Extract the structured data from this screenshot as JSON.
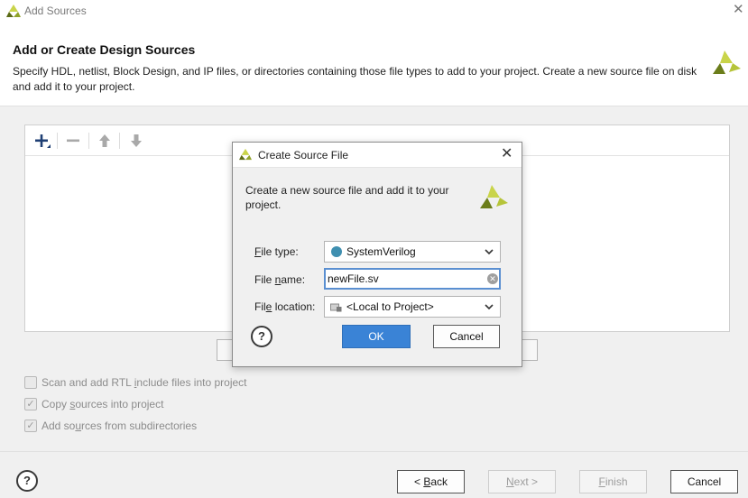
{
  "window": {
    "title": "Add Sources",
    "close_glyph": "✕"
  },
  "header": {
    "title": "Add or Create Design Sources",
    "description": "Specify HDL, netlist, Block Design, and IP files, or directories containing those file types to add to your project. Create a new source file on disk and add it to your project."
  },
  "toolbar": {
    "icons": [
      "add-icon",
      "remove-icon",
      "move-up-icon",
      "move-down-icon"
    ]
  },
  "options": [
    {
      "pre": "Scan and add RTL ",
      "u": "i",
      "post": "nclude files into project",
      "checked": false
    },
    {
      "pre": "Copy ",
      "u": "s",
      "post": "ources into project",
      "checked": true
    },
    {
      "pre": "Add so",
      "u": "u",
      "post": "rces from subdirectories",
      "checked": true
    }
  ],
  "footer": {
    "help": "?",
    "back": {
      "pre": "< ",
      "u": "B",
      "post": "ack"
    },
    "next": {
      "pre": "",
      "u": "N",
      "post": "ext >"
    },
    "finish": {
      "pre": "",
      "u": "F",
      "post": "inish"
    },
    "cancel": "Cancel"
  },
  "dialog": {
    "title": "Create Source File",
    "close_glyph": "✕",
    "description": "Create a new source file and add it to your project.",
    "file_type": {
      "label_u": "F",
      "label_rest": "ile type:",
      "value": "SystemVerilog",
      "dot_color": "#3f8fb0"
    },
    "file_name": {
      "label_u": "",
      "label_pre": "File ",
      "label_u2": "n",
      "label_rest": "ame:",
      "value": "newFile.sv"
    },
    "file_location": {
      "label_pre": "Fil",
      "label_u": "e",
      "label_rest": " location:",
      "value": "<Local to Project>"
    },
    "help": "?",
    "ok": "OK",
    "cancel": "Cancel"
  },
  "colors": {
    "accent": "#3a83d6",
    "logo_dark": "#5b6b15",
    "logo_light": "#c9d44a"
  }
}
